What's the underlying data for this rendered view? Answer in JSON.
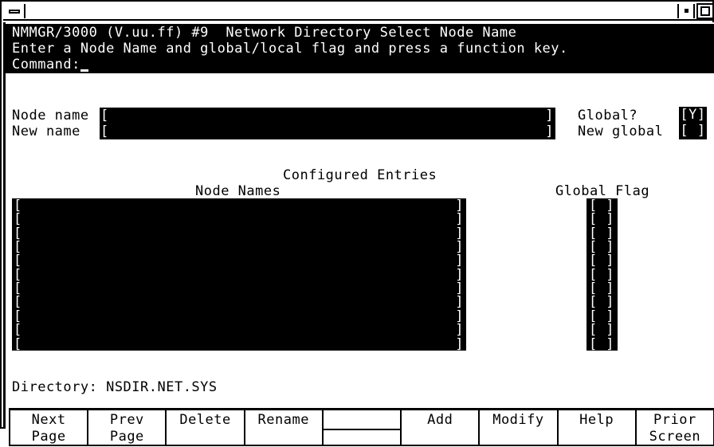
{
  "window": {
    "title": "",
    "controls": {
      "minimize": "minimize-box",
      "restore": "restore-box",
      "maximize": "maximize-box"
    }
  },
  "header": {
    "title_line": "NMMGR/3000 (V.uu.ff) #9  Network Directory Select Node Name",
    "instruction_line": "Enter a Node Name and global/local flag and press a function key.",
    "command_label": "Command:",
    "command_value": ""
  },
  "form": {
    "node_name": {
      "label": "Node name",
      "value": "",
      "bracket_open": "[",
      "bracket_close": "]"
    },
    "new_name": {
      "label": "New name",
      "value": "",
      "bracket_open": "[",
      "bracket_close": "]"
    },
    "global_flag": {
      "label": "Global?",
      "value": "[Y]"
    },
    "new_global_flag": {
      "label": "New global",
      "value": "[ ]"
    }
  },
  "entries": {
    "section_title": "Configured Entries",
    "column_node_names": "Node Names",
    "column_global_flag": "Global Flag",
    "row_count": 11,
    "rows": [
      {
        "node_name": "",
        "global_flag": ""
      },
      {
        "node_name": "",
        "global_flag": ""
      },
      {
        "node_name": "",
        "global_flag": ""
      },
      {
        "node_name": "",
        "global_flag": ""
      },
      {
        "node_name": "",
        "global_flag": ""
      },
      {
        "node_name": "",
        "global_flag": ""
      },
      {
        "node_name": "",
        "global_flag": ""
      },
      {
        "node_name": "",
        "global_flag": ""
      },
      {
        "node_name": "",
        "global_flag": ""
      },
      {
        "node_name": "",
        "global_flag": ""
      },
      {
        "node_name": "",
        "global_flag": ""
      }
    ],
    "bracket_open": "[",
    "bracket_close": "]"
  },
  "status": {
    "directory_line": "Directory: NSDIR.NET.SYS"
  },
  "function_keys": [
    {
      "line1": "Next",
      "line2": "Page"
    },
    {
      "line1": "Prev",
      "line2": "Page"
    },
    {
      "line1": "Delete",
      "line2": ""
    },
    {
      "line1": "Rename",
      "line2": ""
    },
    {
      "line1": "",
      "line2": ""
    },
    {
      "line1": "Add",
      "line2": ""
    },
    {
      "line1": "Modify",
      "line2": ""
    },
    {
      "line1": "Help",
      "line2": ""
    },
    {
      "line1": "Prior",
      "line2": "Screen"
    }
  ],
  "colors": {
    "background": "#ffffff",
    "foreground": "#000000",
    "reverse_background": "#000000",
    "reverse_foreground": "#ffffff"
  }
}
